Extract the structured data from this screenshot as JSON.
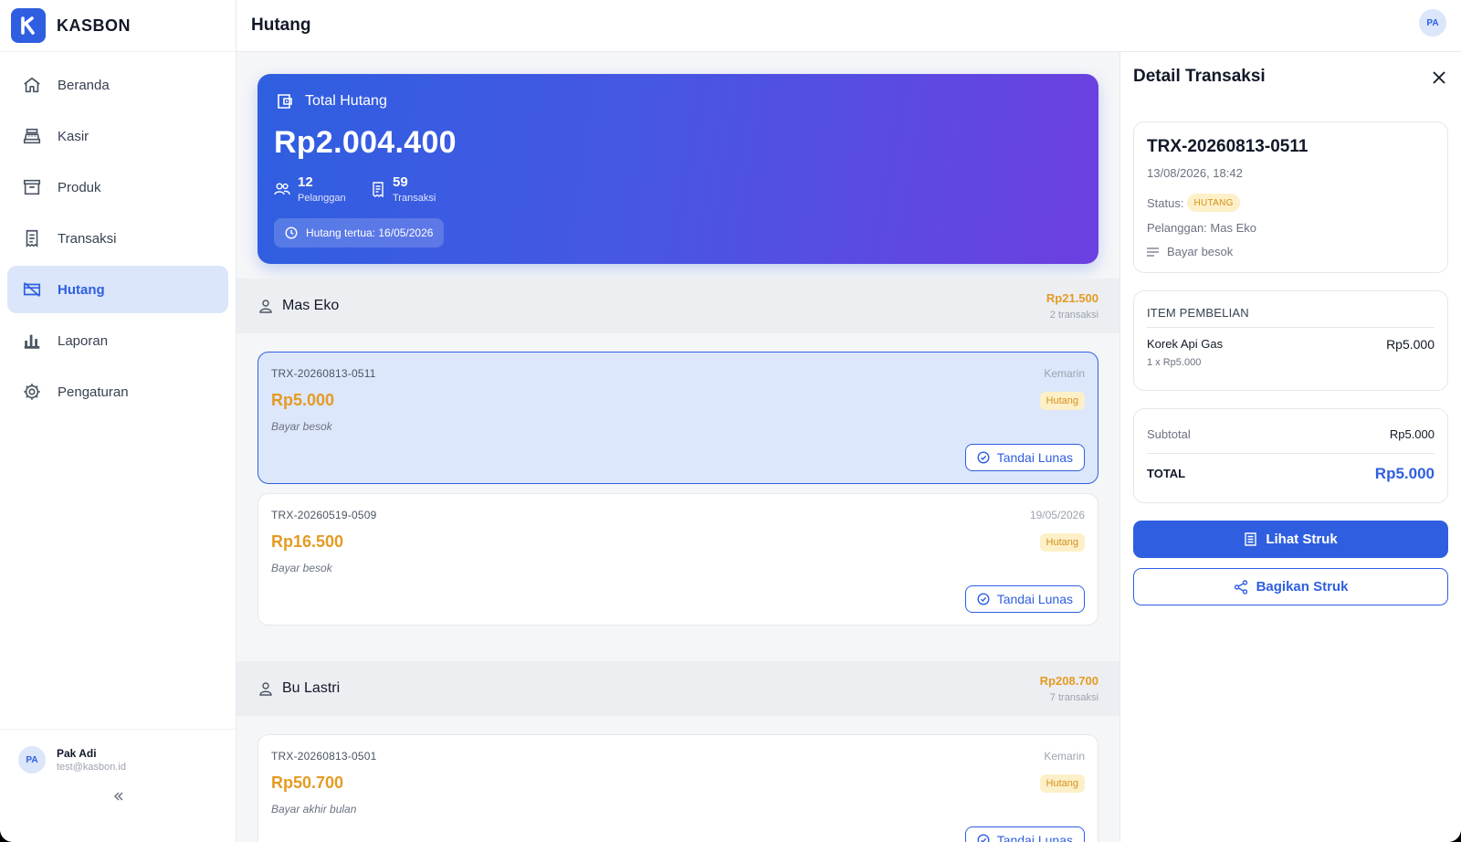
{
  "app": {
    "name": "KASBON",
    "logo_letter": "K",
    "accent": "#2f5fe0",
    "warning": "#e49b22"
  },
  "sidebar": {
    "items": [
      {
        "label": "Beranda",
        "icon": "home-icon"
      },
      {
        "label": "Kasir",
        "icon": "cash-register-icon"
      },
      {
        "label": "Produk",
        "icon": "archive-box-icon"
      },
      {
        "label": "Transaksi",
        "icon": "receipt-icon"
      },
      {
        "label": "Hutang",
        "icon": "debt-card-icon",
        "active": true
      },
      {
        "label": "Laporan",
        "icon": "bar-chart-icon"
      },
      {
        "label": "Pengaturan",
        "icon": "gear-icon"
      }
    ],
    "user": {
      "initials": "PA",
      "name": "Pak Adi",
      "email": "test@kasbon.id"
    },
    "collapse_icon": "chevrons-left-icon"
  },
  "topbar": {
    "title": "Hutang",
    "avatar_initials": "PA"
  },
  "summary": {
    "label": "Total Hutang",
    "amount": "Rp2.004.400",
    "customers_count": "12",
    "customers_label": "Pelanggan",
    "transactions_count": "59",
    "transactions_label": "Transaksi",
    "oldest": "Hutang tertua: 16/05/2026"
  },
  "groups": [
    {
      "customer": "Mas Eko",
      "total": "Rp21.500",
      "count": "2 transaksi",
      "transactions": [
        {
          "id": "TRX-20260813-0511",
          "date": "Kemarin",
          "amount": "Rp5.000",
          "status": "Hutang",
          "note": "Bayar besok",
          "action": "Tandai Lunas",
          "selected": true
        },
        {
          "id": "TRX-20260519-0509",
          "date": "19/05/2026",
          "amount": "Rp16.500",
          "status": "Hutang",
          "note": "Bayar besok",
          "action": "Tandai Lunas"
        }
      ]
    },
    {
      "customer": "Bu Lastri",
      "total": "Rp208.700",
      "count": "7 transaksi",
      "transactions": [
        {
          "id": "TRX-20260813-0501",
          "date": "Kemarin",
          "amount": "Rp50.700",
          "status": "Hutang",
          "note": "Bayar akhir bulan",
          "action": "Tandai Lunas"
        }
      ]
    }
  ],
  "detail": {
    "title": "Detail Transaksi",
    "trx_id": "TRX-20260813-0511",
    "datetime": "13/08/2026, 18:42",
    "status_label": "Status:",
    "status": "HUTANG",
    "customer": "Pelanggan: Mas Eko",
    "note": "Bayar besok",
    "items_title": "ITEM PEMBELIAN",
    "items": [
      {
        "name": "Korek Api Gas",
        "qty": "1 x Rp5.000",
        "price": "Rp5.000"
      }
    ],
    "subtotal_label": "Subtotal",
    "subtotal": "Rp5.000",
    "total_label": "TOTAL",
    "total": "Rp5.000",
    "view_receipt": "Lihat Struk",
    "share_receipt": "Bagikan Struk"
  }
}
